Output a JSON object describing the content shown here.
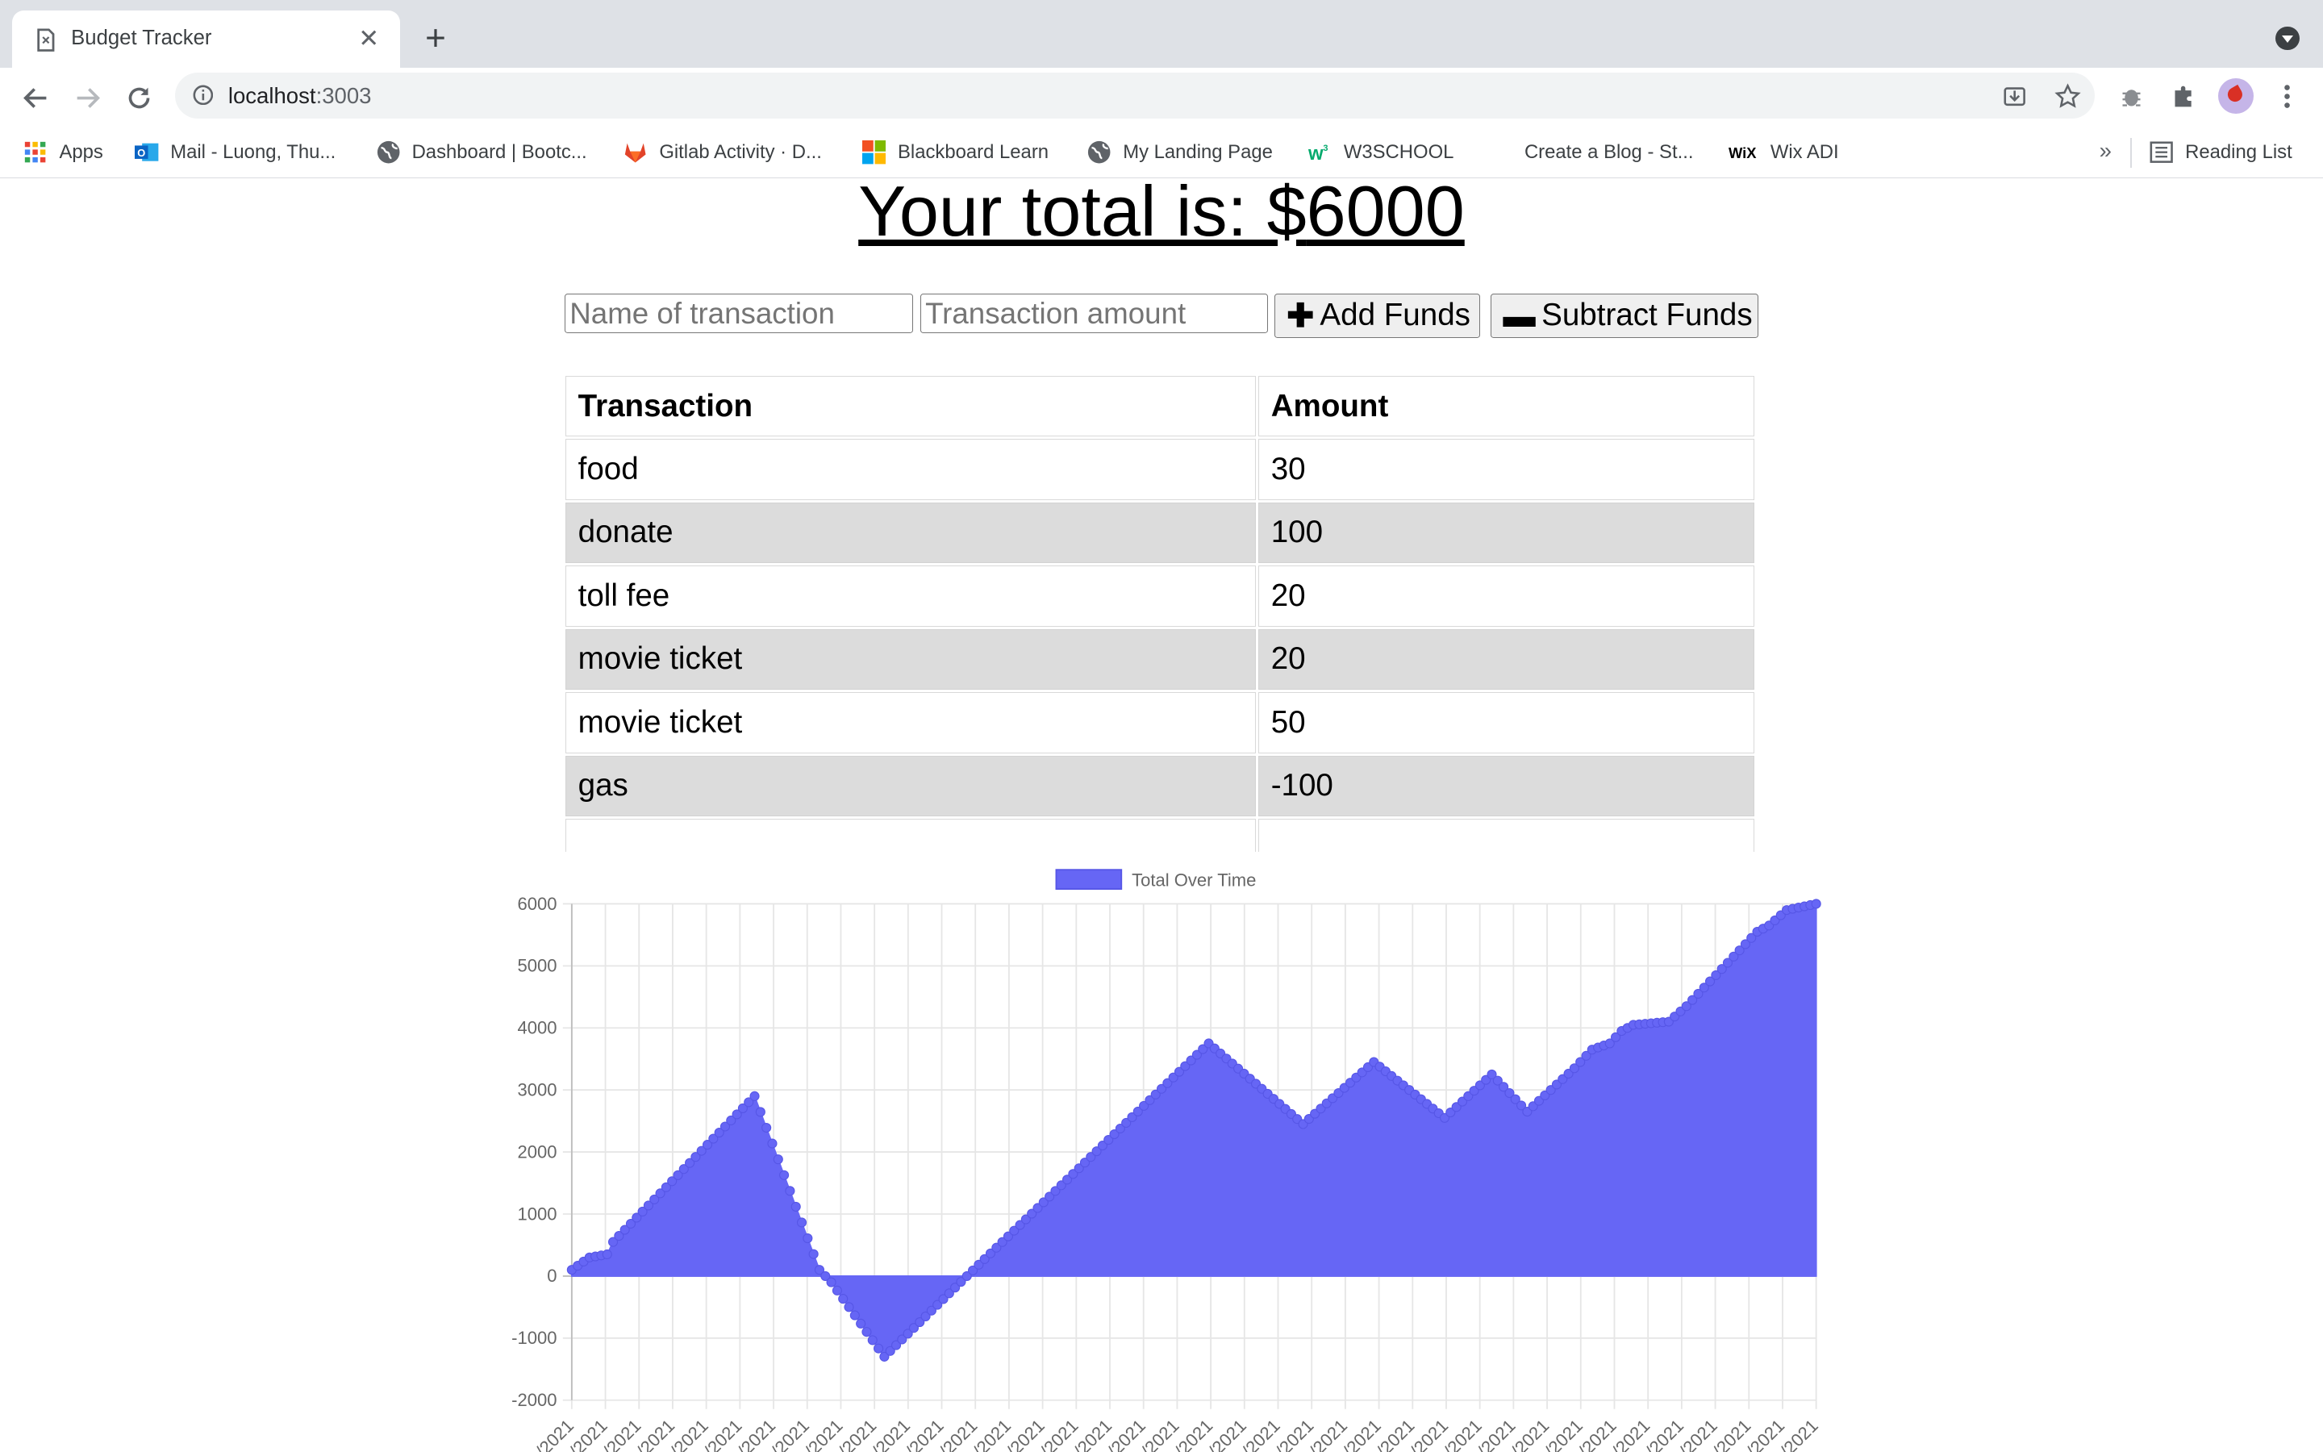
{
  "browser": {
    "tab_title": "Budget Tracker",
    "url_host": "localhost",
    "url_port": ":3003",
    "bookmarks": [
      {
        "label": "Apps",
        "icon": "apps-grid-icon"
      },
      {
        "label": "Mail - Luong, Thu...",
        "icon": "outlook-icon"
      },
      {
        "label": "Dashboard | Bootc...",
        "icon": "globe-icon"
      },
      {
        "label": "Gitlab Activity · D...",
        "icon": "gitlab-icon"
      },
      {
        "label": "Blackboard Learn",
        "icon": "microsoft-icon"
      },
      {
        "label": "My Landing Page",
        "icon": "globe-icon"
      },
      {
        "label": "W3SCHOOL",
        "icon": "w3schools-icon"
      },
      {
        "label": "Create a Blog - St...",
        "icon": "blank-icon"
      },
      {
        "label": "Wix ADI",
        "icon": "wix-icon"
      }
    ],
    "reading_list": "Reading List",
    "more": "»"
  },
  "app": {
    "total_label": "Your total is: $",
    "total_value": "6000",
    "name_placeholder": "Name of transaction",
    "amount_placeholder": "Transaction amount",
    "add_label": "Add Funds",
    "subtract_label": "Subtract Funds",
    "table_headers": [
      "Transaction",
      "Amount"
    ],
    "transactions": [
      {
        "name": "food",
        "amount": "30"
      },
      {
        "name": "donate",
        "amount": "100"
      },
      {
        "name": "toll fee",
        "amount": "20"
      },
      {
        "name": "movie ticket",
        "amount": "20"
      },
      {
        "name": "movie ticket",
        "amount": "50"
      },
      {
        "name": "gas",
        "amount": "-100"
      }
    ]
  },
  "chart_data": {
    "type": "area",
    "series_name": "Total Over Time",
    "color": "#6666f5",
    "ylim": [
      -2000,
      6000
    ],
    "yticks": [
      6000,
      5000,
      4000,
      3000,
      2000,
      1000,
      0,
      -1000,
      -2000
    ],
    "x_tick_label": "/2021",
    "x_tick_count": 38,
    "grid": true,
    "legend": "top",
    "keypoints": [
      [
        0,
        100
      ],
      [
        3,
        300
      ],
      [
        6,
        350
      ],
      [
        7,
        550
      ],
      [
        31,
        2900
      ],
      [
        42,
        100
      ],
      [
        44,
        -100
      ],
      [
        53,
        -1300
      ],
      [
        67,
        0
      ],
      [
        108,
        3750
      ],
      [
        124,
        2450
      ],
      [
        136,
        3450
      ],
      [
        148,
        2550
      ],
      [
        156,
        3250
      ],
      [
        162,
        2650
      ],
      [
        170,
        3350
      ],
      [
        173,
        3650
      ],
      [
        176,
        3750
      ],
      [
        178,
        3950
      ],
      [
        180,
        4050
      ],
      [
        186,
        4100
      ],
      [
        189,
        4350
      ],
      [
        196,
        5050
      ],
      [
        201,
        5550
      ],
      [
        203,
        5650
      ],
      [
        206,
        5900
      ],
      [
        211,
        6000
      ]
    ]
  }
}
